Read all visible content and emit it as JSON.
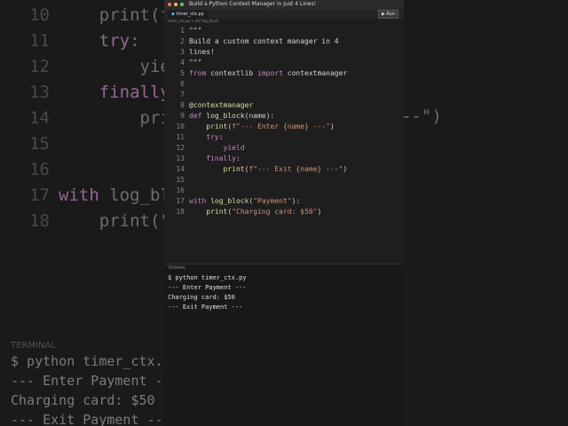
{
  "window": {
    "title": "Build a Python Context Manager in Just 4 Lines!",
    "run_label": "Run",
    "tab_name": "timer_ctx.py",
    "breadcrumb": "timer_ctx.py > def log_block"
  },
  "code_lines": [
    {
      "n": "1",
      "text": "\"\"\""
    },
    {
      "n": "2",
      "text": "Build a custom context manager in 4"
    },
    {
      "n": "3",
      "text": "lines!"
    },
    {
      "n": "4",
      "text": "\"\"\""
    },
    {
      "n": "5",
      "text": "from contextlib import contextmanager"
    },
    {
      "n": "6",
      "text": ""
    },
    {
      "n": "7",
      "text": ""
    },
    {
      "n": "8",
      "text": "@contextmanager"
    },
    {
      "n": "9",
      "text": "def log_block(name):"
    },
    {
      "n": "10",
      "text": "    print(f\"--- Enter {name} ---\")"
    },
    {
      "n": "11",
      "text": "    try:"
    },
    {
      "n": "12",
      "text": "        yield"
    },
    {
      "n": "13",
      "text": "    finally:"
    },
    {
      "n": "14",
      "text": "        print(f\"--- Exit {name} ---\")"
    },
    {
      "n": "15",
      "text": ""
    },
    {
      "n": "16",
      "text": ""
    },
    {
      "n": "17",
      "text": "with log_block(\"Payment\"):"
    },
    {
      "n": "18",
      "text": "    print(\"Charging card: $50\")"
    }
  ],
  "terminal": {
    "label": "TERMINAL",
    "lines": [
      "$ python timer_ctx.py",
      "--- Enter Payment ---",
      "Charging card: $50",
      "--- Exit Payment ---"
    ]
  },
  "background": {
    "code_lines": [
      {
        "n": "10",
        "text": "print(f"
      },
      {
        "n": "11",
        "text": "try:"
      },
      {
        "n": "12",
        "text": "    yiel"
      },
      {
        "n": "13",
        "text": "finally"
      },
      {
        "n": "14",
        "text": "    prin"
      },
      {
        "n": "15",
        "text": ""
      },
      {
        "n": "16",
        "text": ""
      },
      {
        "n": "17",
        "text": "with log_bl"
      },
      {
        "n": "18",
        "text": "print(\""
      }
    ],
    "right_fragment": "--\")",
    "terminal_label": "TERMINAL",
    "terminal_lines": [
      "$ python timer_ctx.p",
      "--- Enter Payment --",
      "Charging card: $50",
      "--- Exit Payment ---"
    ]
  },
  "colors": {
    "keyword": "#c586c0",
    "string": "#ce9178",
    "function": "#dcdcaa",
    "text": "#d4d4d4",
    "background": "#1e1e1e"
  }
}
